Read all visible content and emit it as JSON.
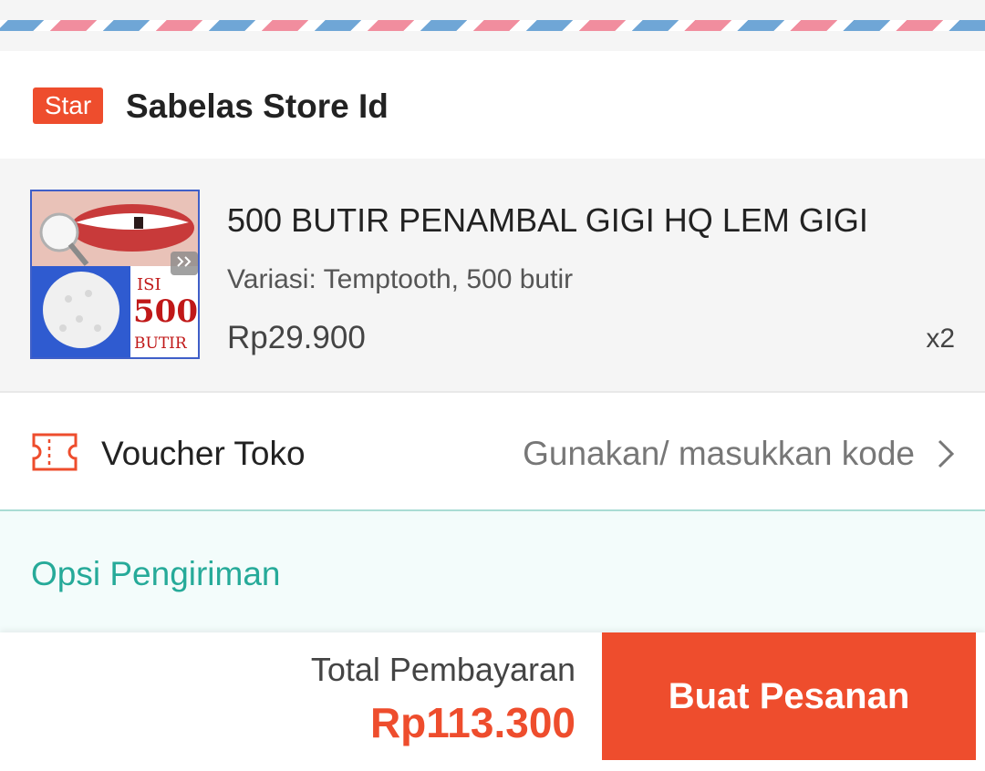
{
  "colors": {
    "accent": "#ee4d2d",
    "shipping_text": "#26aa99",
    "stripe_blue": "#6fa6d6",
    "stripe_pink": "#f18d9e"
  },
  "shop": {
    "badge": "Star",
    "name": "Sabelas Store Id"
  },
  "product": {
    "title": "500 BUTIR PENAMBAL GIGI HQ LEM GIGI",
    "variant": "Variasi: Temptooth, 500 butir",
    "price": "Rp29.900",
    "quantity": "x2",
    "image": {
      "line1": "ISI",
      "line2": "500",
      "line3": "BUTIR"
    }
  },
  "voucher": {
    "icon": "ticket-icon",
    "label": "Voucher Toko",
    "action": "Gunakan/ masukkan kode",
    "chevron_icon": "chevron-right-icon"
  },
  "shipping": {
    "label": "Opsi Pengiriman"
  },
  "footer": {
    "total_label": "Total Pembayaran",
    "total_value": "Rp113.300",
    "button_label": "Buat Pesanan"
  }
}
